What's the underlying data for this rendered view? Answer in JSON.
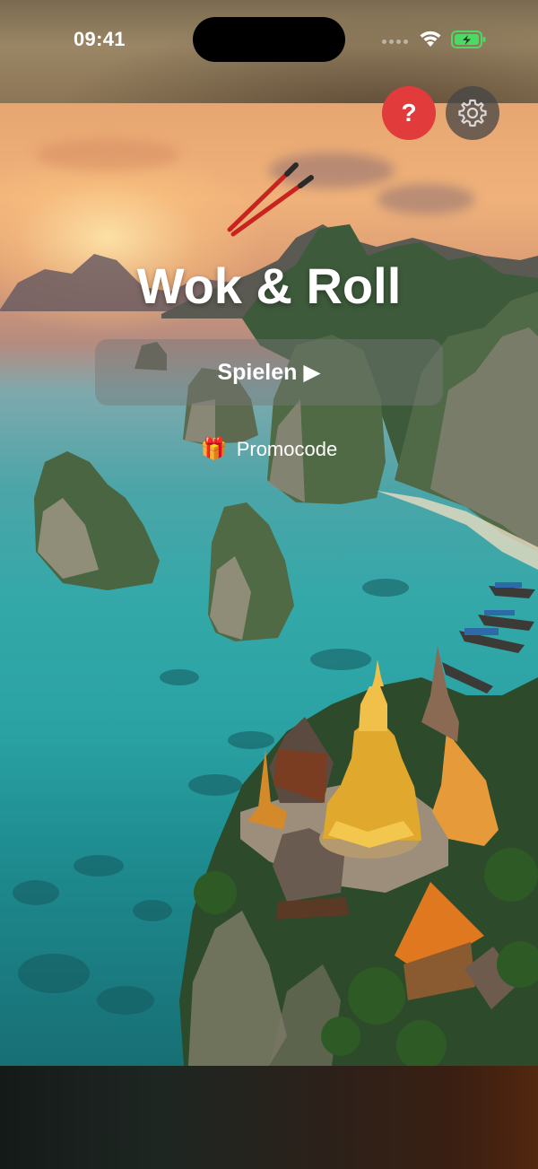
{
  "status_bar": {
    "time": "09:41"
  },
  "header": {
    "help_label": "?",
    "settings_icon": "gear-icon"
  },
  "main": {
    "title": "Wok & Roll",
    "play_button": {
      "label": "Spielen ▶"
    },
    "promo": {
      "icon": "🎁",
      "label": "Promocode"
    }
  },
  "colors": {
    "help_button": "#e23b3b",
    "settings_button": "#464646",
    "play_button_bg": "rgba(120,120,120,0.45)",
    "chopsticks": "#c8241f",
    "battery_fill": "#4cd964"
  }
}
